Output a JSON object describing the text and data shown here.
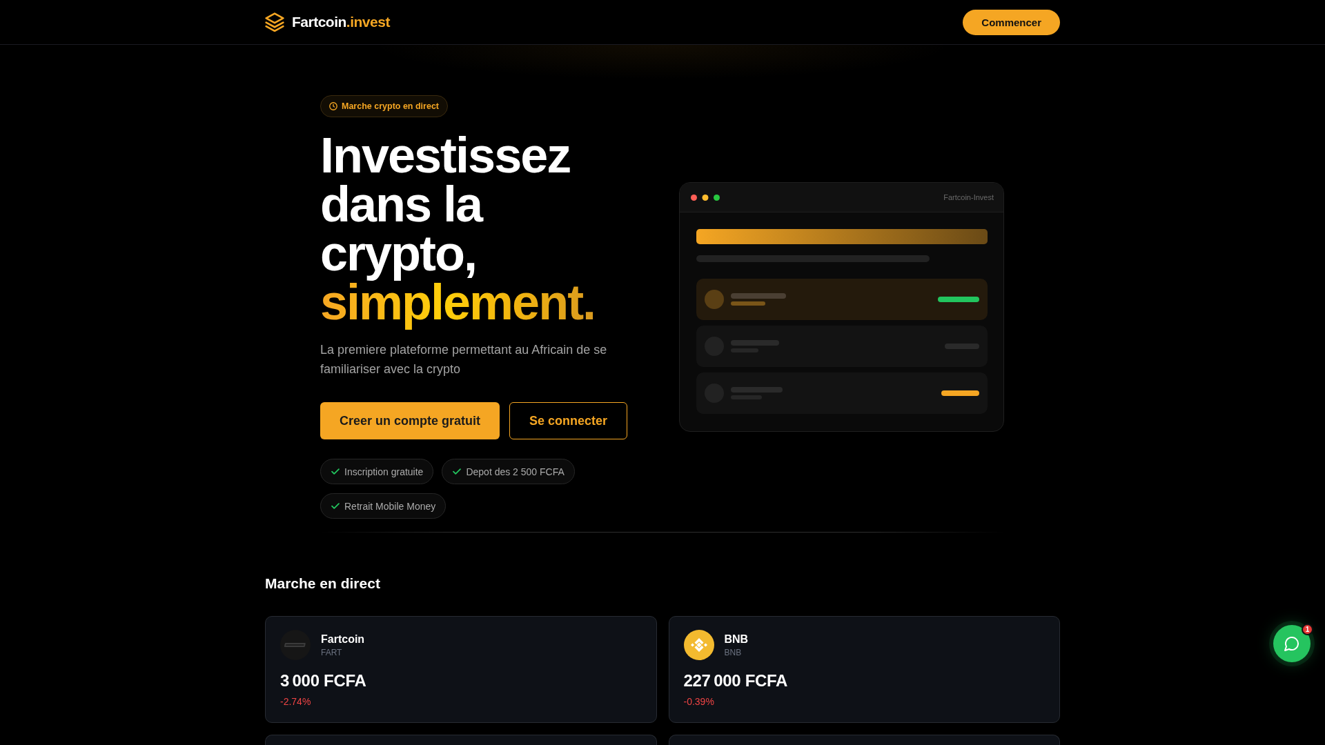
{
  "header": {
    "logo": {
      "name": "Fartcoin",
      "suffix": ".invest"
    },
    "cta": "Commencer"
  },
  "hero": {
    "badge": "Marche crypto en direct",
    "title": "Investissez dans la crypto,",
    "title_highlight": "simplement.",
    "subtitle": "La premiere plateforme permettant au Africain de se familiariser avec la crypto",
    "buttons": [
      {
        "label": "Creer un compte gratuit",
        "kind": "primary"
      },
      {
        "label": "Se connecter",
        "kind": "outline"
      }
    ],
    "features": [
      "Inscription gratuite",
      "Depot des 2 500 FCFA",
      "Retrait Mobile Money"
    ]
  },
  "preview_window": {
    "title": "Fartcoin-Invest"
  },
  "market": {
    "title": "Marche en direct",
    "cards": [
      {
        "name": "Fartcoin",
        "symbol": "FART",
        "price": "3 000 FCFA",
        "change": "-2.74%",
        "negative": true,
        "kind": "wordmark"
      },
      {
        "name": "BNB",
        "symbol": "BNB",
        "price": "227 000 FCFA",
        "change": "-0.39%",
        "negative": true,
        "kind": "cube"
      }
    ]
  },
  "chat": {
    "badge": "1"
  }
}
